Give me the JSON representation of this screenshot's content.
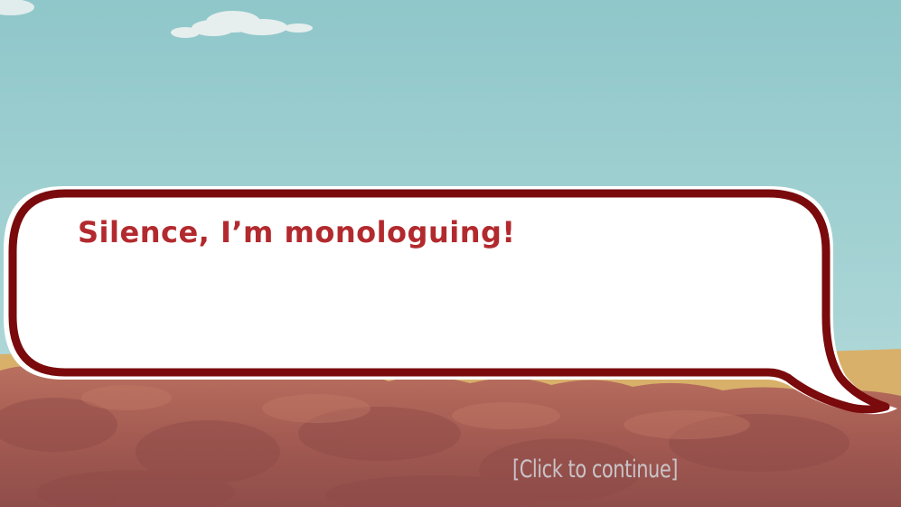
{
  "dialogue": {
    "text": "Silence, I’m monologuing!"
  },
  "prompt": {
    "continue_label": "[Click to continue]"
  },
  "colors": {
    "sky": "#a3d0d1",
    "ground": "#a85f55",
    "bubble_fill": "#ffffff",
    "bubble_outline": "#7a0a0c",
    "text": "#b22a2e",
    "prompt_text": "#c9c4c8"
  }
}
